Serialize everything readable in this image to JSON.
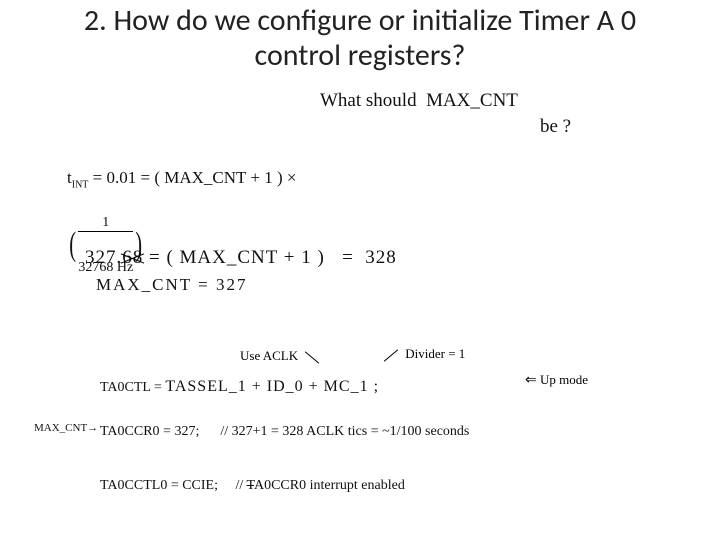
{
  "title": "2. How do we configure or initialize Timer A 0 control registers?",
  "q": {
    "line1": "What should  MAX_CNT",
    "line2": "be ?"
  },
  "eq1": {
    "lhs_var": "t",
    "lhs_sub": "INT",
    "lhs_eq": " = 0.01 = ( MAX_CNT + 1 ) ×",
    "frac_num": "1",
    "frac_den": "32768 Hz"
  },
  "eq2": {
    "lhs_a": "327.",
    "lhs_b": "68",
    "rhs": " = ( MAX_CNT + 1 )   =  328"
  },
  "eq3": "MAX_CNT = 327",
  "ann": {
    "use_aclk": "Use ACLK",
    "divider": "Divider = 1",
    "upmode_arrow": "⇐",
    "upmode": "Up mode"
  },
  "code": {
    "line1_label": "TA0CTL = ",
    "line1_fill": "TASSEL_1  +  ID_0   + MC_1 ;",
    "line2_pre": "MAX_CNT→",
    "line2": "TA0CCR0 = 327;",
    "line2_comment": "// 327+1 = 328 ACLK tics = ~1/100 seconds",
    "line3": "TA0CCTL0 = CCIE;",
    "line3_comment_strike": "T",
    "line3_comment_rest": "A0CCR0 interrupt enabled",
    "line3_comment_prefix": "// "
  }
}
